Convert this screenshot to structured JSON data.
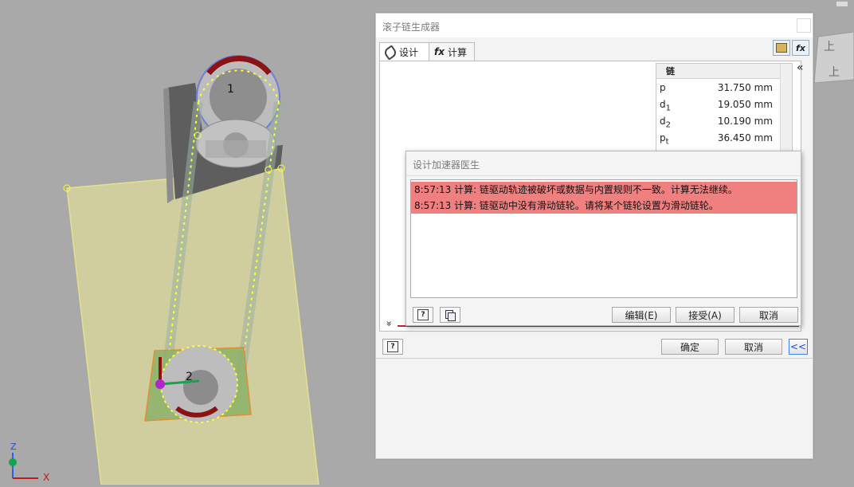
{
  "main_dialog": {
    "title": "滚子链生成器",
    "tabs": [
      {
        "label": "设计",
        "icon": "chain-link-icon"
      },
      {
        "label": "计算",
        "icon": "function-fx-icon"
      }
    ],
    "toolbar": {
      "fx_glyph": "fx"
    },
    "tab_glyph": "fx",
    "params_header": "链",
    "params": [
      {
        "symbol": "p",
        "sub": "",
        "value": "31.750 mm"
      },
      {
        "symbol": "d",
        "sub": "1",
        "value": "19.050 mm"
      },
      {
        "symbol": "d",
        "sub": "2",
        "value": "10.190 mm"
      },
      {
        "symbol": "p",
        "sub": "t",
        "value": "36.450 mm"
      }
    ],
    "collapse_glyph": "«",
    "expand_glyph": "»",
    "buttons": {
      "help": "?",
      "ok": "确定",
      "cancel": "取消",
      "toggle": "<<"
    }
  },
  "doctor_dialog": {
    "title": "设计加速器医生",
    "messages": [
      "8:57:13 计算: 链驱动轨迹被破坏或数据与内置规则不一致。计算无法继续。",
      "8:57:13 计算: 链驱动中没有滑动链轮。请将某个链轮设置为滑动链轮。"
    ],
    "buttons": {
      "help": "?",
      "edit": "编辑(E)",
      "accept": "接受(A)",
      "cancel": "取消"
    }
  },
  "viewport": {
    "sprocket_labels": [
      "1",
      "2"
    ],
    "axes": {
      "z": "Z",
      "x": "X"
    },
    "viewcube_labels": [
      "上",
      "上"
    ]
  },
  "colors": {
    "error_row": "#f07f7f",
    "plane": "#d4d0a0",
    "chain": "#ffff33",
    "background": "#a9a9a9"
  }
}
